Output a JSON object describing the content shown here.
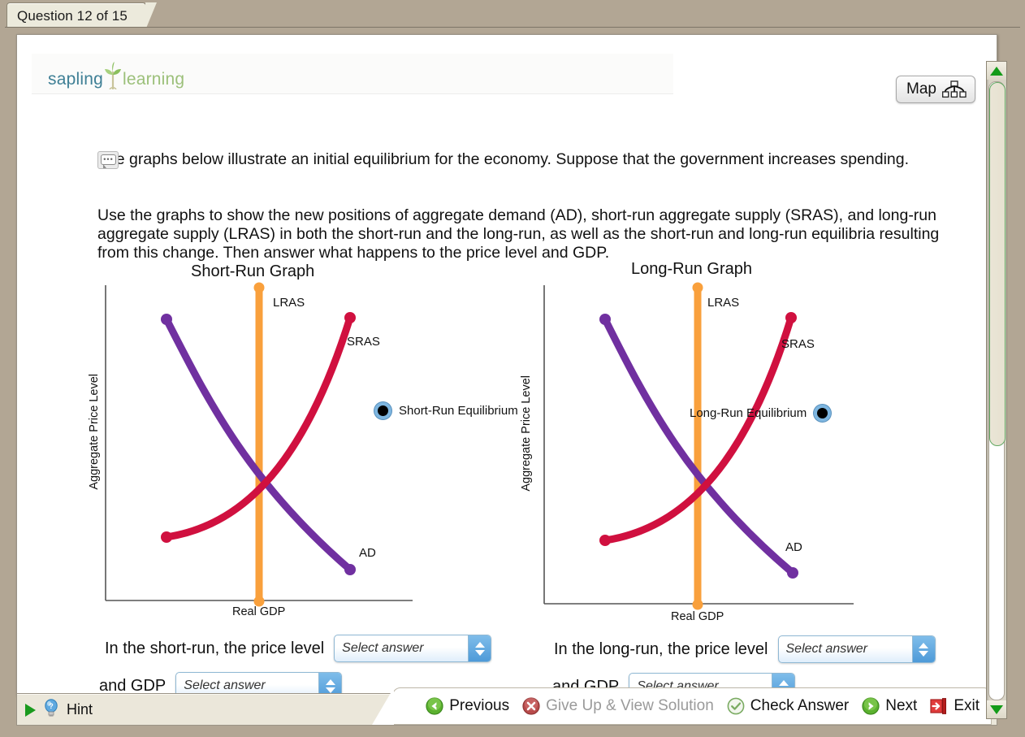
{
  "window": {
    "tab_label": "Question 12 of 15"
  },
  "header": {
    "logo_word1": "sapling",
    "logo_word2": "learning",
    "map_label": "Map",
    "map_icon": "hierarchy-icon"
  },
  "question": {
    "paragraph1": "The graphs below illustrate an initial equilibrium for the economy. Suppose that the government increases spending.",
    "paragraph2": "Use the graphs to show the new positions of aggregate demand (AD), short-run aggregate supply (SRAS), and long-run aggregate supply (LRAS) in both the short-run and the long-run, as well as the short-run and long-run equilibria resulting from this change. Then answer what happens to the price level and GDP.",
    "note_icon": "speech-bubble-icon"
  },
  "chart_data": [
    {
      "type": "line",
      "title": "Short-Run Graph",
      "xlabel": "Real GDP",
      "ylabel": "Aggregate Price Level",
      "grid": false,
      "xlim": [
        0,
        100
      ],
      "ylim": [
        0,
        100
      ],
      "legend": {
        "position": "right-inside",
        "entries": [
          "Short-Run Equilibrium"
        ]
      },
      "annotations": [
        "LRAS",
        "SRAS",
        "AD",
        "Short-Run Equilibrium"
      ],
      "series": [
        {
          "name": "AD",
          "label": "AD",
          "color": "#7030a0",
          "shape": "downward-convex",
          "points": [
            [
              20,
              89
            ],
            [
              33,
              72
            ],
            [
              48,
              53
            ],
            [
              62,
              35
            ],
            [
              78,
              18
            ],
            [
              82,
              13
            ]
          ]
        },
        {
          "name": "SRAS",
          "label": "SRAS",
          "color": "#d0103f",
          "shape": "upward-convex",
          "points": [
            [
              20,
              21
            ],
            [
              33,
              28
            ],
            [
              48,
              38
            ],
            [
              62,
              53
            ],
            [
              74,
              73
            ],
            [
              79,
              89
            ]
          ]
        },
        {
          "name": "LRAS",
          "label": "LRAS",
          "color": "#f9a03c",
          "shape": "vertical",
          "points": [
            [
              50,
              0
            ],
            [
              50,
              100
            ]
          ]
        }
      ],
      "equilibrium_marker": {
        "label": "Short-Run Equilibrium",
        "fill": "#000000",
        "ring": "#7eb6e0"
      }
    },
    {
      "type": "line",
      "title": "Long-Run Graph",
      "xlabel": "Real GDP",
      "ylabel": "Aggregate Price Level",
      "grid": false,
      "xlim": [
        0,
        100
      ],
      "ylim": [
        0,
        100
      ],
      "legend": {
        "position": "right-inside",
        "entries": [
          "Long-Run Equilibrium"
        ]
      },
      "annotations": [
        "LRAS",
        "SRAS",
        "AD",
        "Long-Run Equilibrium"
      ],
      "series": [
        {
          "name": "AD",
          "label": "AD",
          "color": "#7030a0",
          "shape": "downward-convex",
          "points": [
            [
              20,
              89
            ],
            [
              33,
              72
            ],
            [
              48,
              53
            ],
            [
              62,
              35
            ],
            [
              78,
              18
            ],
            [
              82,
              13
            ]
          ]
        },
        {
          "name": "SRAS",
          "label": "SRAS",
          "color": "#d0103f",
          "shape": "upward-convex",
          "points": [
            [
              20,
              21
            ],
            [
              33,
              28
            ],
            [
              48,
              38
            ],
            [
              62,
              53
            ],
            [
              74,
              73
            ],
            [
              79,
              89
            ]
          ]
        },
        {
          "name": "LRAS",
          "label": "LRAS",
          "color": "#f9a03c",
          "shape": "vertical",
          "points": [
            [
              50,
              0
            ],
            [
              50,
              100
            ]
          ]
        }
      ],
      "equilibrium_marker": {
        "label": "Long-Run Equilibrium",
        "fill": "#000000",
        "ring": "#7eb6e0"
      }
    }
  ],
  "answers": {
    "short_run": {
      "prompt1": "In the short-run, the price level",
      "select1_value": "Select answer",
      "prompt2": "and GDP",
      "select2_value": "Select answer"
    },
    "long_run": {
      "prompt1": "In the long-run, the price level",
      "select1_value": "Select answer",
      "prompt2": "and GDP",
      "select2_value": "Select answer"
    }
  },
  "toolbar": {
    "hint_label": "Hint",
    "previous_label": "Previous",
    "giveup_label": "Give Up & View Solution",
    "check_label": "Check Answer",
    "next_label": "Next",
    "exit_label": "Exit"
  }
}
